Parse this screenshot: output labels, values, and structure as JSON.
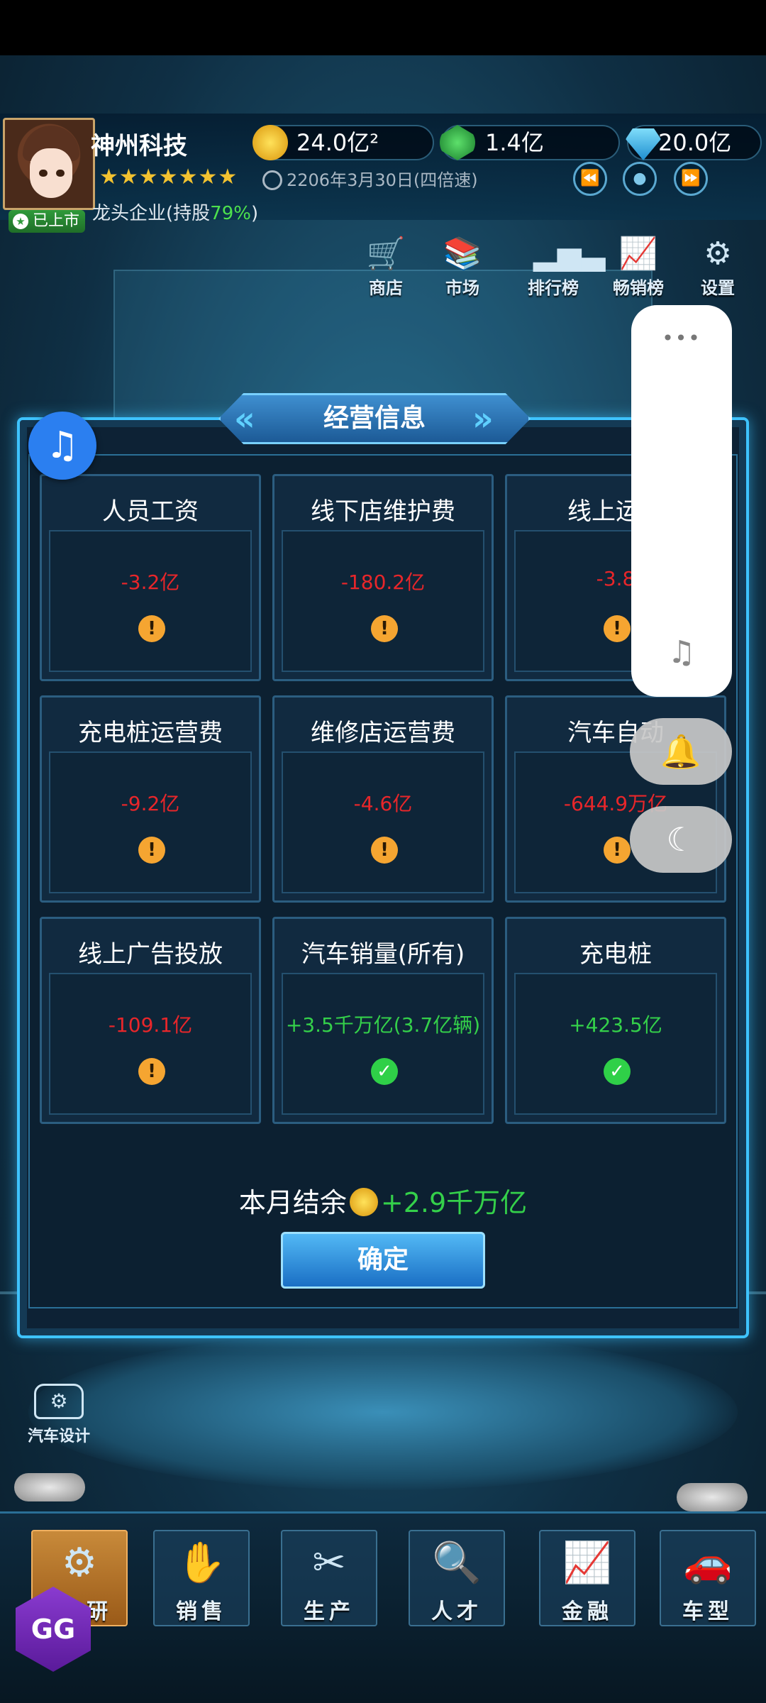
{
  "hud": {
    "company_name": "神州科技",
    "listed_badge": "已上市",
    "stars": "★★★★★★★",
    "date": "2206年3月30日(四倍速)",
    "shares_prefix": "龙头企业(持股",
    "shares_pct": "79%",
    "shares_suffix": ")",
    "gold": "24.0亿²",
    "green": "1.4亿",
    "diamond": "20.0亿",
    "speed_buttons": [
      "⏪",
      "●",
      "⏩"
    ]
  },
  "menu": [
    {
      "label": "商店",
      "icon": "cart-icon"
    },
    {
      "label": "市场",
      "icon": "market-icon"
    },
    {
      "label": "排行榜",
      "icon": "ranking-icon"
    },
    {
      "label": "畅销榜",
      "icon": "bestseller-icon"
    },
    {
      "label": "设置",
      "icon": "gear-icon"
    }
  ],
  "dialog": {
    "title": "经营信息",
    "cards": [
      {
        "title": "人员工资",
        "value": "-3.2亿",
        "status": "warning"
      },
      {
        "title": "线下店维护费",
        "value": "-180.2亿",
        "status": "warning"
      },
      {
        "title": "线上运营",
        "value": "-3.8",
        "status": "warning"
      },
      {
        "title": "充电桩运营费",
        "value": "-9.2亿",
        "status": "warning"
      },
      {
        "title": "维修店运营费",
        "value": "-4.6亿",
        "status": "warning"
      },
      {
        "title": "汽车自动",
        "value": "-644.9万亿",
        "status": "warning"
      },
      {
        "title": "线上广告投放",
        "value": "-109.1亿",
        "status": "warning"
      },
      {
        "title": "汽车销量(所有)",
        "value": "+3.5千万亿(3.7亿辆)",
        "status": "ok"
      },
      {
        "title": "充电桩",
        "value": "+423.5亿",
        "status": "ok"
      }
    ],
    "balance_label": "本月结余",
    "balance_value": "+2.9千万亿",
    "confirm_label": "确定"
  },
  "side_panel": {
    "dots": "•••",
    "music_symbol": "♫",
    "bell_symbol": "🔔",
    "moon_symbol": "☾"
  },
  "music_bubble": "♫",
  "car_design_label": "汽车设计",
  "bottom_nav": [
    {
      "label": "研",
      "icon": "research-icon"
    },
    {
      "label": "销售",
      "icon": "sales-icon"
    },
    {
      "label": "生产",
      "icon": "production-icon"
    },
    {
      "label": "人才",
      "icon": "talent-icon"
    },
    {
      "label": "金融",
      "icon": "finance-icon"
    },
    {
      "label": "车型",
      "icon": "car-model-icon"
    }
  ],
  "gg_logo": "GG",
  "colors": {
    "negative": "#e8262a",
    "positive": "#34d04a",
    "accent": "#3ec3ff"
  }
}
